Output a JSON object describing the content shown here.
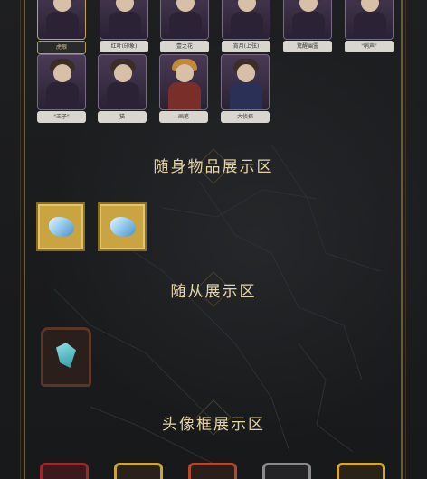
{
  "characters": [
    {
      "label": "虎眼"
    },
    {
      "label": "红叶(印象)"
    },
    {
      "label": "壹之花"
    },
    {
      "label": "宵月(上弦)"
    },
    {
      "label": "驚醒幽霊"
    },
    {
      "label": "\"哨声\""
    },
    {
      "label": "\"王子\""
    },
    {
      "label": "猫"
    },
    {
      "label": "画笔"
    },
    {
      "label": "大侦探"
    }
  ],
  "sections": {
    "items_title": "随身物品展示区",
    "follower_title": "随从展示区",
    "frame_title": "头像框展示区"
  },
  "colors": {
    "accent_gold": "#c9a441",
    "title_text": "#e4d4a8"
  }
}
